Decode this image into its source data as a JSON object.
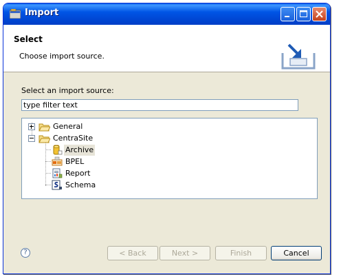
{
  "window": {
    "title": "Import"
  },
  "banner": {
    "title": "Select",
    "description": "Choose import source.",
    "icon": "import-wizard-icon"
  },
  "source_label": "Select an import source:",
  "filter": {
    "value": "type filter text"
  },
  "tree": {
    "items": [
      {
        "label": "General",
        "icon": "folder-icon",
        "expanded": false
      },
      {
        "label": "CentraSite",
        "icon": "folder-open-icon",
        "expanded": true,
        "children": [
          {
            "label": "Archive",
            "icon": "archive-icon",
            "selected": true
          },
          {
            "label": "BPEL",
            "icon": "bpel-icon"
          },
          {
            "label": "Report",
            "icon": "report-icon"
          },
          {
            "label": "Schema",
            "icon": "schema-icon"
          }
        ]
      }
    ]
  },
  "buttons": {
    "help": "?",
    "back": "< Back",
    "next": "Next >",
    "finish": "Finish",
    "cancel": "Cancel"
  }
}
